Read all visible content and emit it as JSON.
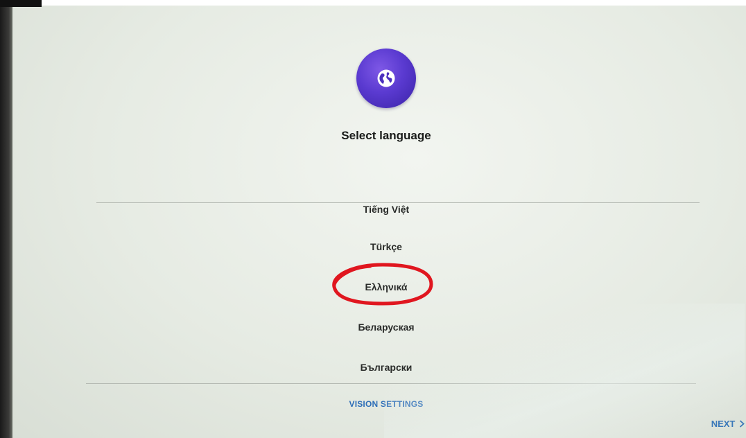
{
  "screen": {
    "title": "Select language",
    "globe_icon": "globe-icon"
  },
  "languages": [
    {
      "label": "Tiếng Việt"
    },
    {
      "label": "Türkçe"
    },
    {
      "label": "Ελληνικά"
    },
    {
      "label": "Беларуская"
    },
    {
      "label": "Български"
    }
  ],
  "footer": {
    "vision_settings_label": "VISION SETTINGS",
    "next_label": "NEXT",
    "next_icon": "chevron-right-icon"
  },
  "colors": {
    "accent_blue": "#2f6fb8",
    "globe_purple": "#5a3ad0",
    "annotation_red": "#e0161f"
  }
}
